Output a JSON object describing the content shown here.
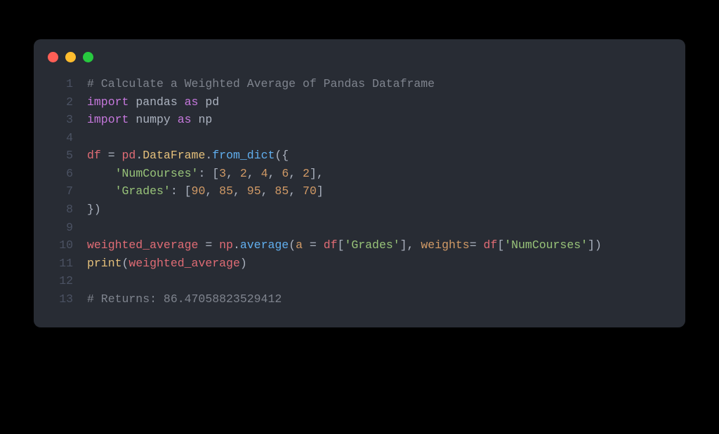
{
  "window": {
    "traffic_lights": [
      "red",
      "yellow",
      "green"
    ]
  },
  "code": {
    "lines": [
      {
        "num": "1",
        "tokens": [
          {
            "cls": "tok-comment",
            "t": "# Calculate a Weighted Average of Pandas Dataframe"
          }
        ]
      },
      {
        "num": "2",
        "tokens": [
          {
            "cls": "tok-keyword",
            "t": "import"
          },
          {
            "cls": "tok-module",
            "t": " pandas "
          },
          {
            "cls": "tok-keyword",
            "t": "as"
          },
          {
            "cls": "tok-module",
            "t": " pd"
          }
        ]
      },
      {
        "num": "3",
        "tokens": [
          {
            "cls": "tok-keyword",
            "t": "import"
          },
          {
            "cls": "tok-module",
            "t": " numpy "
          },
          {
            "cls": "tok-keyword",
            "t": "as"
          },
          {
            "cls": "tok-module",
            "t": " np"
          }
        ]
      },
      {
        "num": "4",
        "tokens": []
      },
      {
        "num": "5",
        "tokens": [
          {
            "cls": "tok-var",
            "t": "df"
          },
          {
            "cls": "tok-op",
            "t": " = "
          },
          {
            "cls": "tok-var",
            "t": "pd"
          },
          {
            "cls": "tok-punct",
            "t": "."
          },
          {
            "cls": "tok-cls",
            "t": "DataFrame"
          },
          {
            "cls": "tok-punct",
            "t": "."
          },
          {
            "cls": "tok-func",
            "t": "from_dict"
          },
          {
            "cls": "tok-punct",
            "t": "({"
          }
        ]
      },
      {
        "num": "6",
        "tokens": [
          {
            "cls": "tok-punct",
            "t": "    "
          },
          {
            "cls": "tok-string",
            "t": "'NumCourses'"
          },
          {
            "cls": "tok-punct",
            "t": ": ["
          },
          {
            "cls": "tok-num",
            "t": "3"
          },
          {
            "cls": "tok-punct",
            "t": ", "
          },
          {
            "cls": "tok-num",
            "t": "2"
          },
          {
            "cls": "tok-punct",
            "t": ", "
          },
          {
            "cls": "tok-num",
            "t": "4"
          },
          {
            "cls": "tok-punct",
            "t": ", "
          },
          {
            "cls": "tok-num",
            "t": "6"
          },
          {
            "cls": "tok-punct",
            "t": ", "
          },
          {
            "cls": "tok-num",
            "t": "2"
          },
          {
            "cls": "tok-punct",
            "t": "],"
          }
        ]
      },
      {
        "num": "7",
        "tokens": [
          {
            "cls": "tok-punct",
            "t": "    "
          },
          {
            "cls": "tok-string",
            "t": "'Grades'"
          },
          {
            "cls": "tok-punct",
            "t": ": ["
          },
          {
            "cls": "tok-num",
            "t": "90"
          },
          {
            "cls": "tok-punct",
            "t": ", "
          },
          {
            "cls": "tok-num",
            "t": "85"
          },
          {
            "cls": "tok-punct",
            "t": ", "
          },
          {
            "cls": "tok-num",
            "t": "95"
          },
          {
            "cls": "tok-punct",
            "t": ", "
          },
          {
            "cls": "tok-num",
            "t": "85"
          },
          {
            "cls": "tok-punct",
            "t": ", "
          },
          {
            "cls": "tok-num",
            "t": "70"
          },
          {
            "cls": "tok-punct",
            "t": "]"
          }
        ]
      },
      {
        "num": "8",
        "tokens": [
          {
            "cls": "tok-punct",
            "t": "})"
          }
        ]
      },
      {
        "num": "9",
        "tokens": []
      },
      {
        "num": "10",
        "tokens": [
          {
            "cls": "tok-var",
            "t": "weighted_average"
          },
          {
            "cls": "tok-op",
            "t": " = "
          },
          {
            "cls": "tok-var",
            "t": "np"
          },
          {
            "cls": "tok-punct",
            "t": "."
          },
          {
            "cls": "tok-func",
            "t": "average"
          },
          {
            "cls": "tok-punct",
            "t": "("
          },
          {
            "cls": "tok-param",
            "t": "a"
          },
          {
            "cls": "tok-op",
            "t": " = "
          },
          {
            "cls": "tok-var",
            "t": "df"
          },
          {
            "cls": "tok-punct",
            "t": "["
          },
          {
            "cls": "tok-string",
            "t": "'Grades'"
          },
          {
            "cls": "tok-punct",
            "t": "], "
          },
          {
            "cls": "tok-param",
            "t": "weights"
          },
          {
            "cls": "tok-op",
            "t": "= "
          },
          {
            "cls": "tok-var",
            "t": "df"
          },
          {
            "cls": "tok-punct",
            "t": "["
          },
          {
            "cls": "tok-string",
            "t": "'NumCourses'"
          },
          {
            "cls": "tok-punct",
            "t": "])"
          }
        ]
      },
      {
        "num": "11",
        "tokens": [
          {
            "cls": "tok-builtin",
            "t": "print"
          },
          {
            "cls": "tok-punct",
            "t": "("
          },
          {
            "cls": "tok-var",
            "t": "weighted_average"
          },
          {
            "cls": "tok-punct",
            "t": ")"
          }
        ]
      },
      {
        "num": "12",
        "tokens": []
      },
      {
        "num": "13",
        "tokens": [
          {
            "cls": "tok-comment",
            "t": "# Returns: 86.47058823529412"
          }
        ]
      }
    ]
  }
}
